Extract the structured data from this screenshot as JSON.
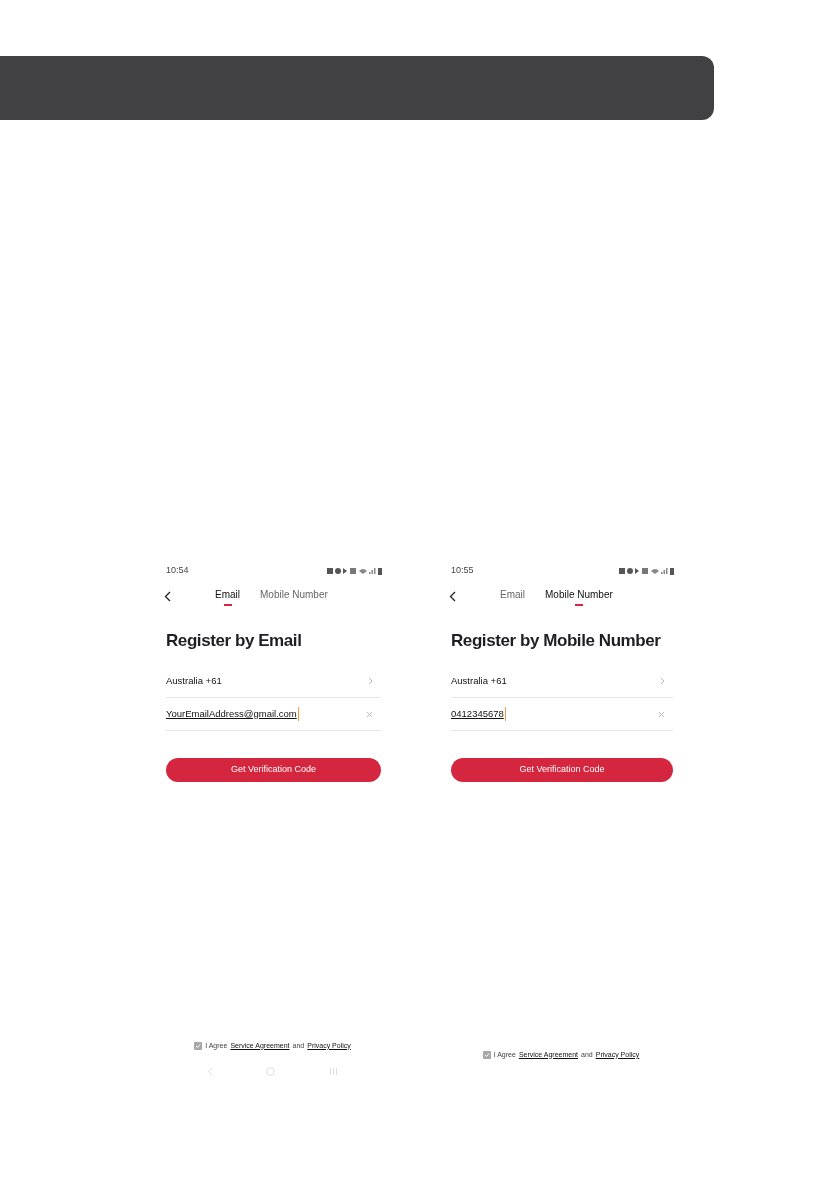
{
  "screens": [
    {
      "time": "10:54",
      "tabs": [
        {
          "label": "Email",
          "selected": true
        },
        {
          "label": "Mobile Number",
          "selected": false
        }
      ],
      "title": "Register by Email",
      "fields": [
        {
          "kind": "picker",
          "value": "Australia +61"
        },
        {
          "kind": "input",
          "value": "YourEmailAddress@gmail.com"
        }
      ],
      "button": "Get Verification Code",
      "agree": {
        "checked": true,
        "prefix": "I Agree",
        "link_1": "Service Agreement",
        "middle": "and",
        "link_2": "Privacy Policy"
      },
      "system_nav": true
    },
    {
      "time": "10:55",
      "tabs": [
        {
          "label": "Email",
          "selected": false
        },
        {
          "label": "Mobile Number",
          "selected": true
        }
      ],
      "title": "Register by Mobile Number",
      "fields": [
        {
          "kind": "picker",
          "value": "Australia +61"
        },
        {
          "kind": "input",
          "value": "0412345678"
        }
      ],
      "button": "Get Verification Code",
      "agree": {
        "checked": true,
        "prefix": "I Agree",
        "link_1": "Service Agreement",
        "middle": "and",
        "link_2": "Privacy Policy"
      },
      "system_nav": false
    }
  ]
}
